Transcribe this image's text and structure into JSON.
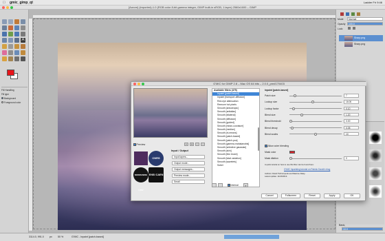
{
  "menubar": {
    "apple": "",
    "app_name": "gmic_gimp_qt",
    "right_status": "Ladder   Fri 9:46"
  },
  "window": {
    "title": "[Aurore] (imported)-1.0 (RGB color 8-bit gamma integer, GIMP built-in sRGB, 1 layer) 2560x1600 – GIMP"
  },
  "toolbox": {
    "fg_color": "#e8141a",
    "bg_color": "#ffffff",
    "options_title": "Fill Handling",
    "fill_options": [
      "Fill type",
      "Background",
      "Foreground color"
    ]
  },
  "layers_panel": {
    "mode_label": "Mode",
    "mode_value": "Normal",
    "opacity_label": "Opacity",
    "opacity_value": "100.0",
    "lock_label": "Lock:",
    "layers": [
      "Sharp.png",
      "Sharp.png"
    ]
  },
  "brushes_panel": {
    "preset_label": "Basic,",
    "spacing_value": "10.0"
  },
  "statusbar": {
    "coords": "3114.0, 991.0",
    "unit": "px",
    "zoom": "50 %",
    "status_text": "G'MIC - Inpaint [patch-based]"
  },
  "dialog": {
    "title": "G'MIC for GIMP 2.8 – Mac OS 64 bits – 2.0.0_pre#170403",
    "preview_label": "Preview",
    "io_title": "Input / Output",
    "io_combos": [
      "Input layers...",
      "Output mode...",
      "Output messages...",
      "Preview mode...",
      "Small"
    ],
    "logos": [
      "GREYC",
      "CNRS",
      "NORMANDIE UNIV",
      "ENSI CAEN"
    ],
    "filters_header": "Available filters (375)",
    "filters": [
      {
        "label": "Inpaint [patch-based]",
        "selected": true
      },
      {
        "label": "Inpaint [transport-diffusion]",
        "selected": false
      },
      {
        "label": "Red-eye attenuation",
        "selected": false
      },
      {
        "label": "Remove hot pixels",
        "selected": false
      },
      {
        "label": "Smooth [anisotropic]",
        "selected": false
      },
      {
        "label": "Smooth [antialias]",
        "selected": false
      },
      {
        "label": "Smooth [bilateral]",
        "selected": false
      },
      {
        "label": "Smooth [diffusion]",
        "selected": false
      },
      {
        "label": "Smooth [guided]",
        "selected": false
      },
      {
        "label": "Smooth [mean-curvature]",
        "selected": false
      },
      {
        "label": "Smooth [median]",
        "selected": false
      },
      {
        "label": "Smooth [nl-means]",
        "selected": false
      },
      {
        "label": "Smooth [patch-based]",
        "selected": false
      },
      {
        "label": "Smooth [patch-pca]",
        "selected": false
      },
      {
        "label": "Smooth [gamma-mahalanobis]",
        "selected": false
      },
      {
        "label": "Smooth [selective gaussian]",
        "selected": false
      },
      {
        "label": "Smooth [skin]",
        "selected": false
      },
      {
        "label": "Smooth [thin brush]",
        "selected": false
      },
      {
        "label": "Smooth [total variation]",
        "selected": false
      },
      {
        "label": "Smooth [wavelets]",
        "selected": false
      },
      {
        "label": "Sobel",
        "selected": false
      }
    ],
    "internal_label": "Internal",
    "filter_title": "Inpaint [patch-based]",
    "params": [
      {
        "label": "Patch size",
        "value": "7",
        "frac": 0.08
      },
      {
        "label": "Lookup size",
        "value": "16.00",
        "frac": 0.45
      },
      {
        "label": "Lookup factor",
        "value": "0.10",
        "frac": 0.05
      },
      {
        "label": "Blend size",
        "value": "1.20",
        "frac": 0.22
      },
      {
        "label": "Blend threshold",
        "value": "0.00",
        "frac": 0.0
      },
      {
        "label": "Blend decay",
        "value": "0.05",
        "frac": 0.03
      },
      {
        "label": "Blend scales",
        "value": "10",
        "frac": 0.5
      }
    ],
    "outer_blending_label": "Allow outer blending",
    "mask_color_label": "Mask color",
    "mask_color": "#e0252b",
    "mask_dilation_label": "Mask dilation",
    "mask_dilation_value": "0",
    "tutorial_text": "A quick tutorial on how to use this filter can be found here:",
    "tutorial_link": "G'MIC Inpainting tutorial on Patrick David's blog",
    "authors": "Authors: David Tschumperlé and Maxime Daisy.",
    "latest_update": "Latest update: 11/20/2013.",
    "buttons": {
      "cancel": "Cancel",
      "fullscreen": "Fullscreen",
      "reset": "Reset",
      "apply": "Apply",
      "ok": "OK"
    }
  }
}
